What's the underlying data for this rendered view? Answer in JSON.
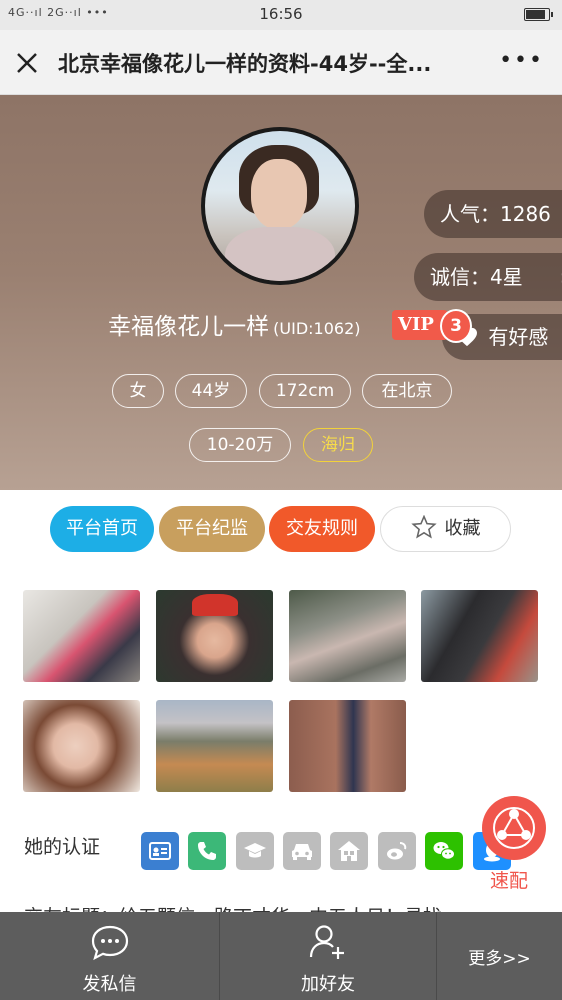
{
  "status_bar": {
    "signal": "4G··ıl 2G··ıl •••",
    "time": "16:56",
    "battery_level": 0.85
  },
  "navbar": {
    "title": "北京幸福像花儿一样的资料-44岁--全...",
    "close_icon": "close-icon",
    "more_icon": "more-icon"
  },
  "profile": {
    "popularity": "人气：1286",
    "credit": "诚信：4星",
    "like": "有好感",
    "name": "幸福像花儿一样",
    "uid": "(UID:1062)",
    "vip_label": "VIP",
    "vip_level": "3",
    "tags": [
      "女",
      "44岁",
      "172cm",
      "在北京"
    ],
    "tags2": [
      "10-20万",
      "海归"
    ]
  },
  "actions": {
    "home": "平台首页",
    "discipline": "平台纪监",
    "rules": "交友规则",
    "favorite": "收藏"
  },
  "photos_alt": [
    "photo-1",
    "photo-2",
    "photo-3",
    "photo-4",
    "photo-5",
    "photo-6",
    "photo-7"
  ],
  "certification": {
    "label": "她的认证",
    "icons": [
      "id-card-icon",
      "phone-icon",
      "education-icon",
      "car-icon",
      "house-icon",
      "weibo-icon",
      "wechat-icon",
      "qq-icon"
    ],
    "colors": [
      "#3b7fd1",
      "#3cb878",
      "#bdbdbd",
      "#bdbdbd",
      "#bdbdbd",
      "#bdbdbd",
      "#2dc100",
      "#1e90ff"
    ]
  },
  "fab": {
    "label": "速配"
  },
  "cut_text": "交友标题：给五颗信，路丁才华，内五人日！寻找",
  "bottom_bar": {
    "message": "发私信",
    "add_friend": "加好友",
    "more": "更多>>"
  }
}
